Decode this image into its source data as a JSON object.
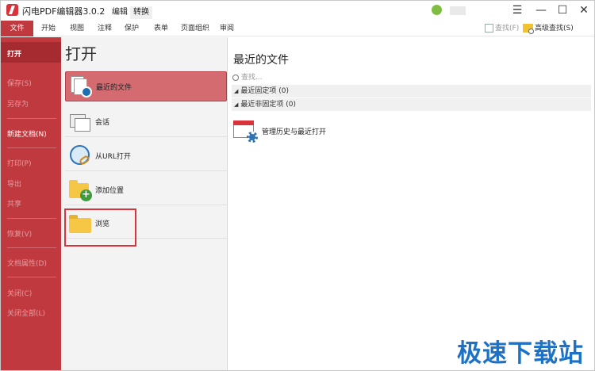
{
  "titlebar": {
    "app_title": "闪电PDF编辑器3.0.2",
    "tabs": [
      "编辑",
      "转换"
    ],
    "window_buttons": [
      "menu-icon",
      "minimize-icon",
      "maximize-icon",
      "close-icon"
    ]
  },
  "ribbon": {
    "tabs": [
      "文件",
      "开始",
      "视图",
      "注释",
      "保护",
      "表单",
      "页面组织",
      "审阅"
    ],
    "active_tab": "文件",
    "search_label": "查找(F)",
    "advanced_search_label": "高级查找(S)"
  },
  "sidebar": {
    "items": [
      {
        "label": "打开",
        "enabled": true
      },
      {
        "label": "保存(S)",
        "enabled": false
      },
      {
        "label": "另存为",
        "enabled": false
      },
      {
        "label": "新建文档(N)",
        "enabled": true
      },
      {
        "label": "打印(P)",
        "enabled": false
      },
      {
        "label": "导出",
        "enabled": false
      },
      {
        "label": "共享",
        "enabled": false
      },
      {
        "label": "恢复(V)",
        "enabled": false
      },
      {
        "label": "文档属性(D)",
        "enabled": false
      },
      {
        "label": "关闭(C)",
        "enabled": false
      },
      {
        "label": "关闭全部(L)",
        "enabled": false
      }
    ]
  },
  "open_panel": {
    "heading": "打开",
    "options": [
      {
        "label": "最近的文件",
        "icon": "recent-files-icon",
        "selected": true
      },
      {
        "label": "会话",
        "icon": "session-icon"
      },
      {
        "label": "从URL打开",
        "icon": "globe-link-icon"
      },
      {
        "label": "添加位置",
        "icon": "folder-add-icon"
      },
      {
        "label": "浏览",
        "icon": "folder-icon"
      }
    ]
  },
  "recent_panel": {
    "title": "最近的文件",
    "search_placeholder": "查找...",
    "groups": [
      "最近固定项 (0)",
      "最近非固定项 (0)"
    ],
    "history_item": "管理历史与最近打开"
  },
  "watermark": "极速下载站",
  "colors": {
    "accent": "#c0393f",
    "highlight_outline": "#d9333b",
    "watermark": "#1e72c5"
  }
}
